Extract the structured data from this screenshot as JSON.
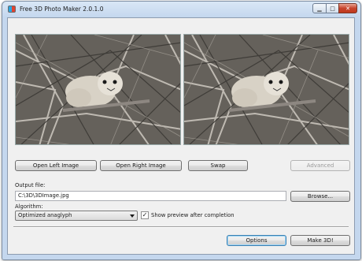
{
  "window": {
    "title": "Free 3D Photo Maker 2.0.1.0",
    "minimize_glyph": "▁",
    "maximize_glyph": "□",
    "close_glyph": "✕"
  },
  "images": {
    "left": "bird-on-branches-left",
    "right": "bird-on-branches-right"
  },
  "buttons": {
    "open_left": "Open Left Image",
    "open_right": "Open Right Image",
    "swap": "Swap",
    "advanced": "Advanced",
    "browse": "Browse...",
    "options": "Options",
    "make3d": "Make 3D!"
  },
  "output": {
    "label": "Output file:",
    "value": "C:\\3D\\3DImage.jpg"
  },
  "algorithm": {
    "label": "Algorithm:",
    "selected": "Optimized anaglyph"
  },
  "preview": {
    "checked_glyph": "✓",
    "label": "Show preview after completion"
  }
}
